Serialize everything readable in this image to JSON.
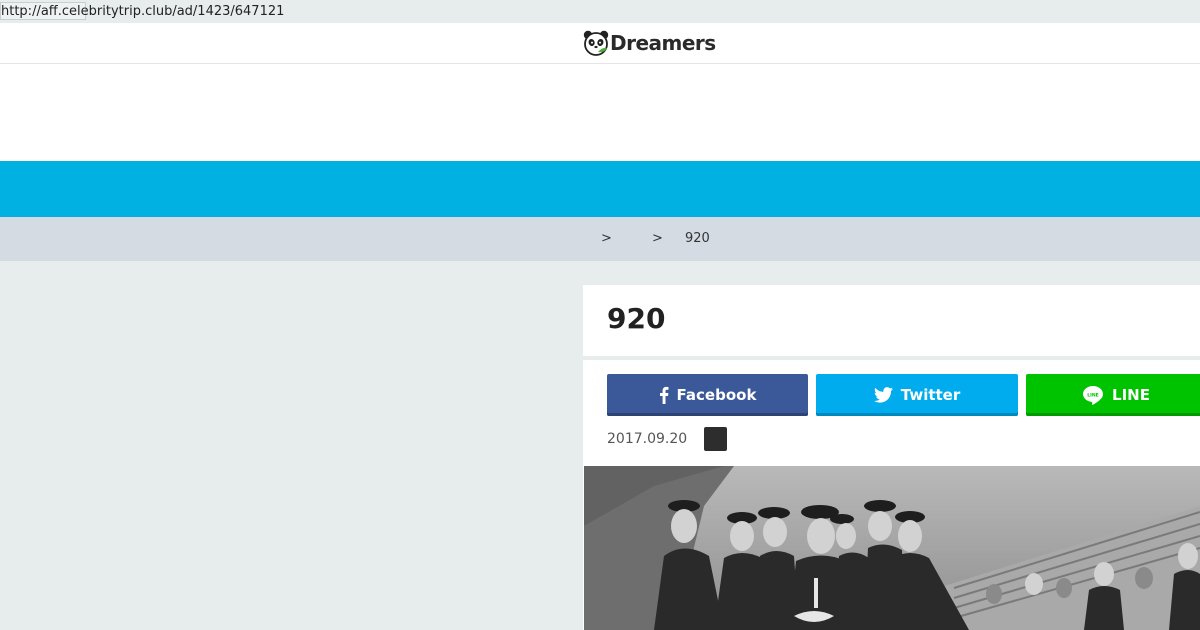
{
  "browser": {
    "status_url": "http://aff.celebritytrip.club/ad/1423/647121"
  },
  "header": {
    "logo_text": "Dreamers",
    "logo_icon": "panda-icon"
  },
  "breadcrumb": {
    "separator_1": ">",
    "separator_2": ">",
    "current": "920"
  },
  "article": {
    "title": "920",
    "date": "2017.09.20",
    "photo": "black-and-white group photo of men in school caps and uniforms"
  },
  "share": {
    "facebook_label": "Facebook",
    "twitter_label": "Twitter",
    "line_label": "LINE",
    "facebook_icon": "facebook-icon",
    "twitter_icon": "twitter-icon",
    "line_icon": "line-icon"
  },
  "colors": {
    "nav_blue": "#00b1e1",
    "facebook": "#3b5998",
    "twitter": "#00acee",
    "line": "#00c300",
    "breadcrumb_bg": "#d5dbe3",
    "page_bg": "#e7eced"
  }
}
